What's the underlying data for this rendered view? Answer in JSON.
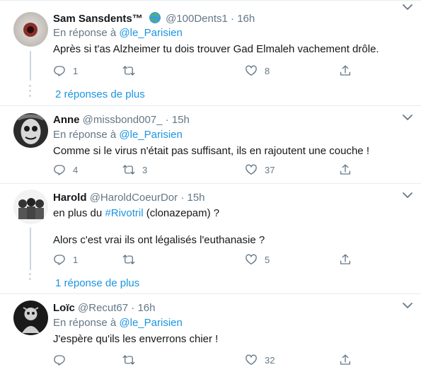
{
  "replying_to_label": "En réponse à",
  "tweets": [
    {
      "name": "Sam Sansdents™",
      "handle": "@100Dents1",
      "time": "16h",
      "flag_icon": "globe-emoji",
      "mention": "@le_Parisien",
      "text": "Après si t'as Alzheimer tu dois trouver Gad Elmaleh vachement drôle.",
      "replies": "1",
      "retweets": "",
      "likes": "8",
      "more_replies": "2 réponses de plus"
    },
    {
      "name": "Anne",
      "handle": "@missbond007_",
      "time": "15h",
      "mention": "@le_Parisien",
      "text": "Comme si le virus n'était pas suffisant, ils en rajoutent une couche !",
      "replies": "4",
      "retweets": "3",
      "likes": "37"
    },
    {
      "name": "Harold",
      "handle": "@HaroldCoeurDor",
      "time": "15h",
      "text_prefix": "en plus du ",
      "hashtag": "#Rivotril",
      "text_suffix": " (clonazepam) ?",
      "text2": "Alors c'est vrai ils ont légalisés l'euthanasie ?",
      "replies": "1",
      "retweets": "",
      "likes": "5",
      "more_replies": "1 réponse de plus"
    },
    {
      "name": "Loïc",
      "handle": "@Recut67",
      "time": "16h",
      "mention": "@le_Parisien",
      "text": "J'espère qu'ils les enverrons chier !",
      "likes": "32"
    }
  ],
  "colors": {
    "link": "#1b95e0",
    "muted": "#657786",
    "border": "#e6ecf0"
  }
}
